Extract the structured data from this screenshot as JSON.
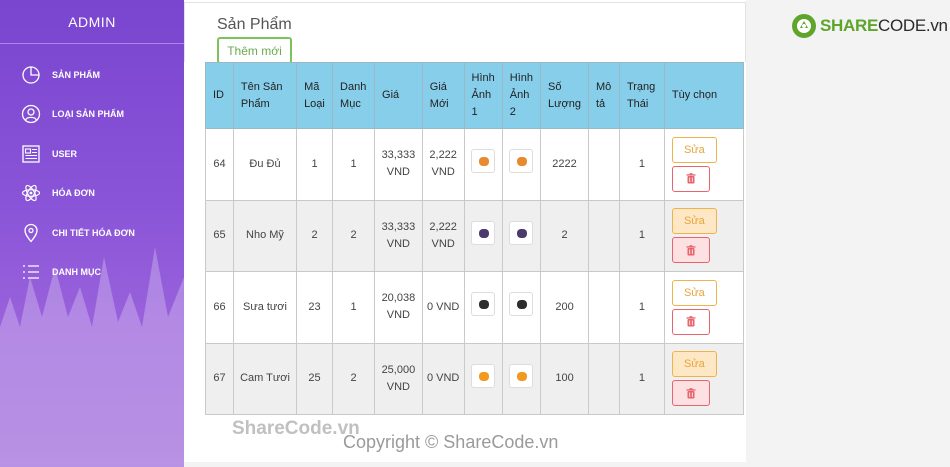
{
  "sidebar": {
    "brand": "ADMIN",
    "items": [
      {
        "label": "SẢN PHẨM",
        "icon": "pie-chart-icon"
      },
      {
        "label": "LOẠI SẢN PHẨM",
        "icon": "user-circle-icon"
      },
      {
        "label": "USER",
        "icon": "newspaper-icon"
      },
      {
        "label": "HÓA ĐƠN",
        "icon": "atom-icon"
      },
      {
        "label": "CHI TIẾT HÓA ĐƠN",
        "icon": "map-pin-icon"
      },
      {
        "label": "DANH MỤC",
        "icon": "list-icon"
      }
    ]
  },
  "panel": {
    "title": "Sản Phẩm",
    "add_label": "Thêm mới"
  },
  "table": {
    "headers": [
      "ID",
      "Tên Sản Phẩm",
      "Mã Loại",
      "Danh Mục",
      "Giá",
      "Giá Mới",
      "Hình Ảnh 1",
      "Hình Ảnh 2",
      "Số Lượng",
      "Mô tả",
      "Trạng Thái",
      "Tùy chọn"
    ],
    "edit_label": "Sửa",
    "rows": [
      {
        "id": "64",
        "name": "Đu Đủ",
        "type": "1",
        "category": "1",
        "price": "33,333 VND",
        "new_price": "2,222 VND",
        "qty": "2222",
        "desc": "",
        "status": "1",
        "fruit_color": "#e88a2f"
      },
      {
        "id": "65",
        "name": "Nho Mỹ",
        "type": "2",
        "category": "2",
        "price": "33,333 VND",
        "new_price": "2,222 VND",
        "qty": "2",
        "desc": "",
        "status": "1",
        "fruit_color": "#4b3a6e"
      },
      {
        "id": "66",
        "name": "Sưa tươi",
        "type": "23",
        "category": "1",
        "price": "20,038 VND",
        "new_price": "0 VND",
        "qty": "200",
        "desc": "",
        "status": "1",
        "fruit_color": "#2d2d2d"
      },
      {
        "id": "67",
        "name": "Cam Tươi",
        "type": "25",
        "category": "2",
        "price": "25,000 VND",
        "new_price": "0 VND",
        "qty": "100",
        "desc": "",
        "status": "1",
        "fruit_color": "#f29a1f"
      }
    ]
  },
  "watermark": {
    "top": "ShareCode.vn",
    "bottom": "Copyright © ShareCode.vn"
  },
  "logo": {
    "share": "SHARE",
    "code": "CODE.vn"
  }
}
